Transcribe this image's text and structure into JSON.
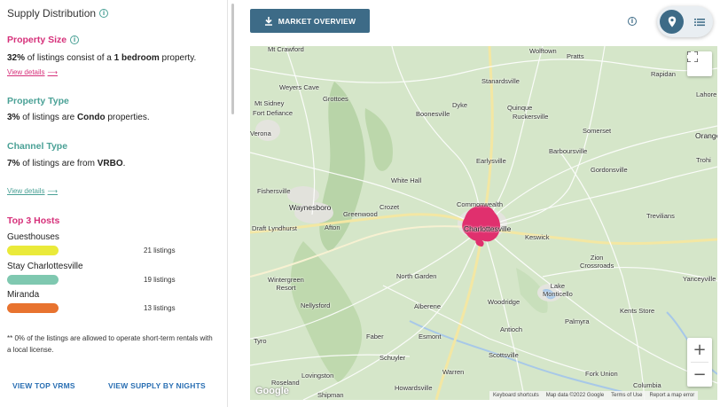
{
  "left_panel": {
    "title": "Supply Distribution",
    "property_size": {
      "heading": "Property Size",
      "pct": "32%",
      "text_a": " of listings consist of a ",
      "value": "1 bedroom",
      "text_b": " property.",
      "link": "View details"
    },
    "property_type": {
      "heading": "Property Type",
      "pct": "3%",
      "text_a": " of listings are ",
      "value": "Condo",
      "text_b": " properties."
    },
    "channel_type": {
      "heading": "Channel Type",
      "pct": "7%",
      "text_a": " of listings are from ",
      "value": "VRBO",
      "text_b": ".",
      "link": "View details"
    },
    "top_hosts": {
      "heading": "Top 3 Hosts",
      "hosts": [
        {
          "name": "Guesthouses",
          "count": "21 listings",
          "color": "#eaea3a"
        },
        {
          "name": "Stay Charlottesville",
          "count": "19 listings",
          "color": "#7fc8b0"
        },
        {
          "name": "Miranda",
          "count": "13 listings",
          "color": "#e8732f"
        }
      ]
    },
    "footnote": "** 0% of the listings are allowed to operate short-term rentals with a local license.",
    "links": {
      "top_vrms": "VIEW TOP VRMS",
      "supply_by_nights": "VIEW SUPPLY BY NIGHTS"
    }
  },
  "toolbar": {
    "market_button": "MARKET OVERVIEW",
    "download_icon": "download-icon",
    "view_toggle": {
      "active": "map",
      "icons": [
        "map-pin-icon",
        "list-icon"
      ]
    }
  },
  "map": {
    "labels": {
      "mt_crawford": "Mt Crawford",
      "wolftown": "Wolftown",
      "pratts": "Pratts",
      "weyers_cave": "Weyers Cave",
      "grottoes": "Grottoes",
      "stanardsville": "Stanardsville",
      "rapidan": "Rapidan",
      "mt_sidney": "Mt Sidney",
      "fort_defiance": "Fort Defiance",
      "boonesville": "Boonesville",
      "dyke": "Dyke",
      "quinque": "Quinque",
      "ruckersville": "Ruckersville",
      "verona": "Verona",
      "somerset": "Somerset",
      "orange": "Orange",
      "barboursville": "Barboursville",
      "gordonsville": "Gordonsville",
      "earlysville": "Earlysville",
      "fishersville": "Fishersville",
      "white_hall": "White Hall",
      "waynesboro": "Waynesboro",
      "crozet": "Crozet",
      "commonwealth": "Commonwealth",
      "greenwood": "Greenwood",
      "trevilians": "Trevilians",
      "draft_lyndhurst": "Draft Lyndhurst",
      "afton": "Afton",
      "charlottesville": "Charlottesville",
      "keswick": "Keswick",
      "zion_crossroads": "Zion\nCrossroads",
      "wintergreen_resort": "Wintergreen\nResort",
      "north_garden": "North Garden",
      "lake_monticello": "Lake\nMonticello",
      "yanceyville": "Yanceyville",
      "nellysford": "Nellysford",
      "alberene": "Alberene",
      "woodridge": "Woodridge",
      "kents_store": "Kents Store",
      "palmyra": "Palmyra",
      "antioch": "Antioch",
      "tyro": "Tyro",
      "faber": "Faber",
      "esmont": "Esmont",
      "schuyler": "Schuyler",
      "scottsville": "Scottsville",
      "fork_union": "Fork Union",
      "roseland": "Roseland",
      "lovingston": "Lovingston",
      "warren": "Warren",
      "columbia": "Columbia",
      "shipman": "Shipman",
      "howardsville": "Howardsville",
      "lahore": "Lahore",
      "trohi": "Trohi"
    },
    "attribution": {
      "shortcuts": "Keyboard shortcuts",
      "data": "Map data ©2022 Google",
      "terms": "Terms of Use",
      "report": "Report a map error"
    },
    "google_logo": "Google",
    "highlight_color": "#e0306e"
  }
}
